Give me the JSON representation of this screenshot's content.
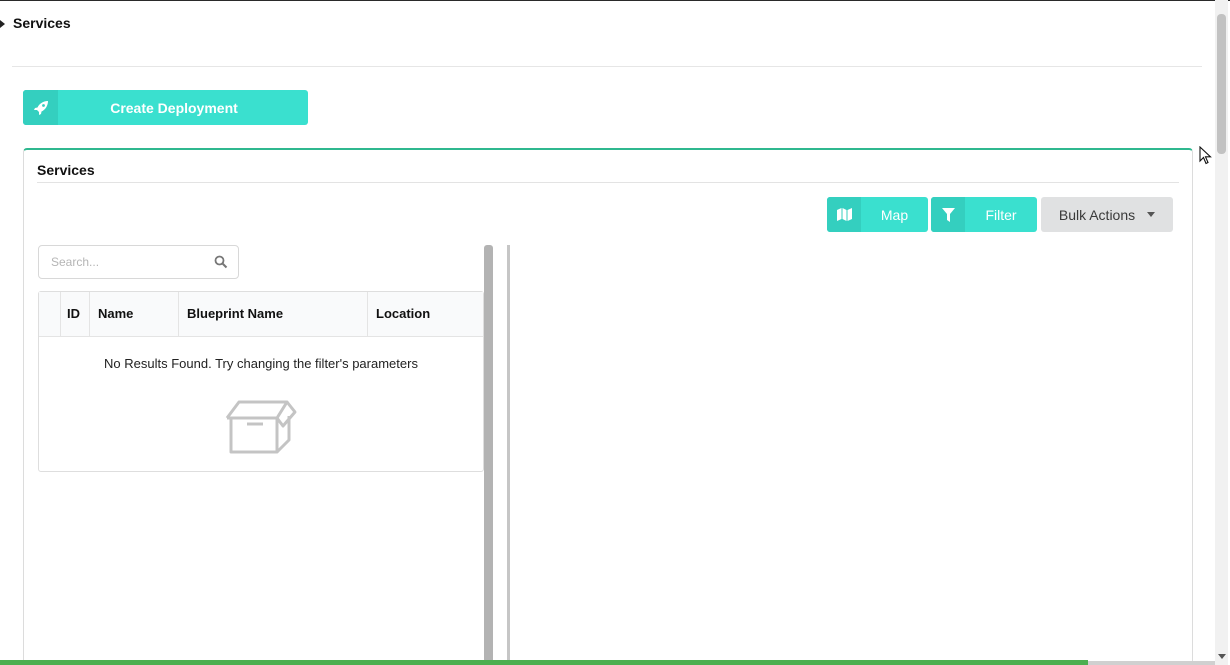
{
  "page": {
    "title": "Services"
  },
  "actions": {
    "create_deployment_label": "Create Deployment"
  },
  "segment": {
    "header": "Services"
  },
  "toolbar": {
    "map_label": "Map",
    "filter_label": "Filter",
    "bulk_actions_label": "Bulk Actions"
  },
  "search": {
    "placeholder": "Search...",
    "value": ""
  },
  "table": {
    "columns": [
      "ID",
      "Name",
      "Blueprint Name",
      "Location"
    ],
    "rows": [],
    "empty_message": "No Results Found. Try changing the filter's parameters"
  },
  "icons": {
    "create": "rocket-icon",
    "map": "map-icon",
    "filter": "filter-icon",
    "search": "search-icon",
    "empty": "open-box-icon"
  },
  "colors": {
    "accent": "#3ae0cf",
    "accent_dark": "#34cfbf",
    "segment_border": "#2fb88f",
    "neutral_button": "#e0e1e2"
  }
}
